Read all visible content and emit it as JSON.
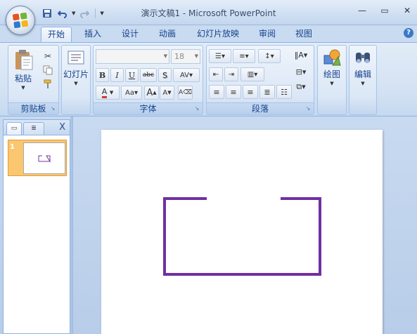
{
  "window": {
    "title": "演示文稿1 - Microsoft PowerPoint",
    "controls": {
      "minimize": "—",
      "maximize": "▭",
      "close": "✕"
    }
  },
  "quick_access": {
    "save_icon": "save-icon",
    "undo_icon": "undo-icon",
    "redo_icon": "redo-icon",
    "customize_icon": "customize-qat-icon"
  },
  "tabs": [
    {
      "label": "开始",
      "active": true
    },
    {
      "label": "插入"
    },
    {
      "label": "设计"
    },
    {
      "label": "动画"
    },
    {
      "label": "幻灯片放映"
    },
    {
      "label": "审阅"
    },
    {
      "label": "视图"
    }
  ],
  "ribbon": {
    "clipboard": {
      "label": "剪贴板",
      "paste": "粘贴"
    },
    "slides": {
      "new_slide": "幻灯片"
    },
    "font": {
      "label": "字体",
      "font_name": "",
      "font_size": "18"
    },
    "paragraph": {
      "label": "段落"
    },
    "drawing": {
      "label": "绘图"
    },
    "editing": {
      "label": "编辑"
    }
  },
  "slide_pane": {
    "close": "X",
    "slide_number": "1"
  },
  "colors": {
    "accent": "#7030a0",
    "thumbnail_selected": "#fbc670"
  }
}
